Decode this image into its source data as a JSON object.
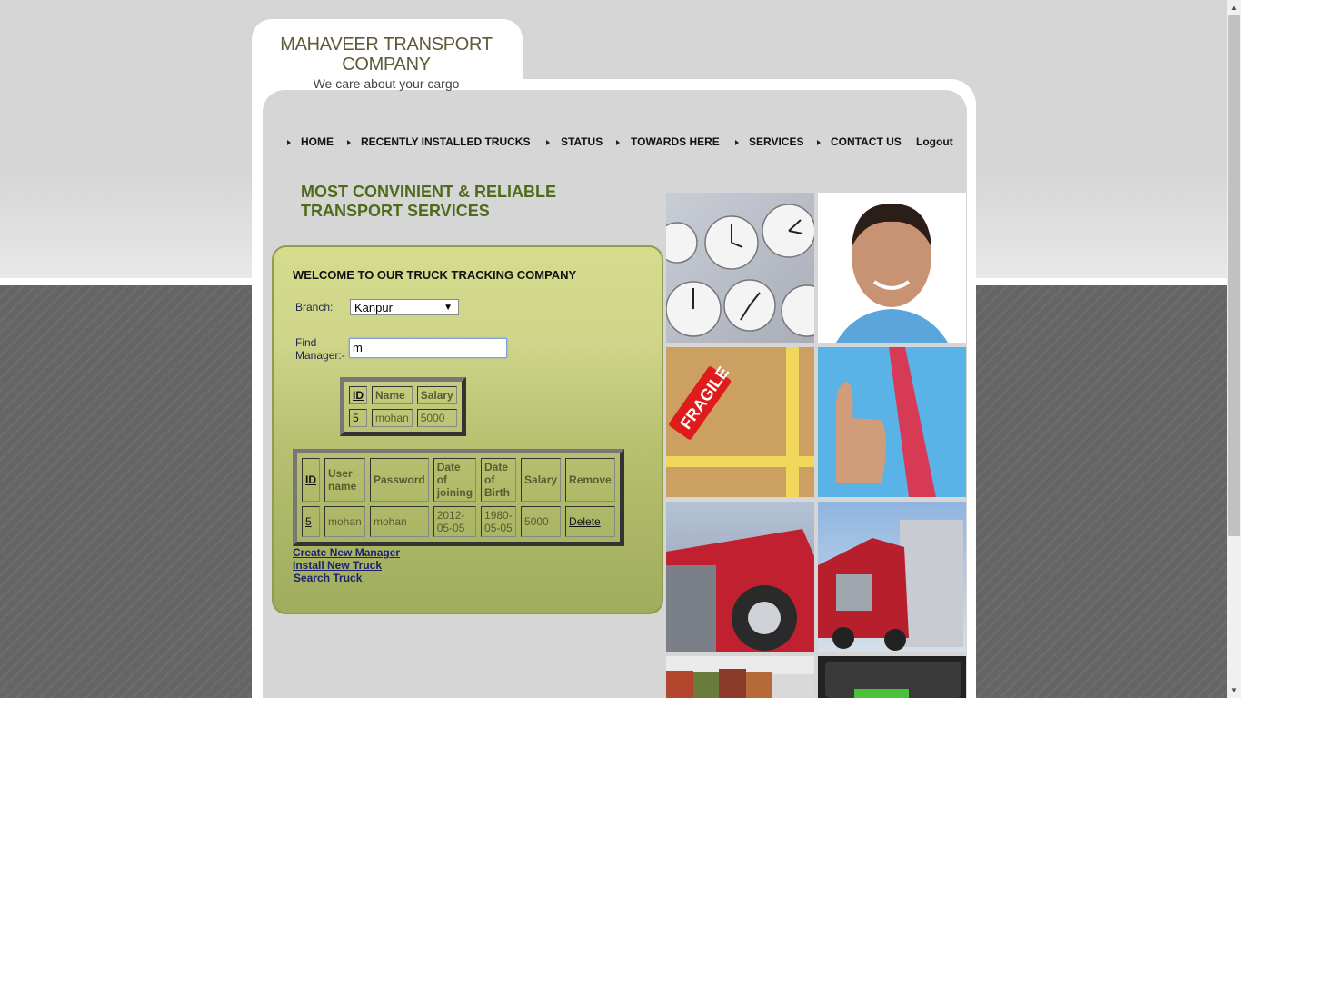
{
  "header": {
    "company_name": "MAHAVEER TRANSPORT COMPANY",
    "tagline": "We care about your cargo"
  },
  "nav": {
    "items": [
      "HOME",
      "RECENTLY INSTALLED TRUCKS",
      "STATUS",
      "TOWARDS HERE",
      "SERVICES",
      "CONTACT US",
      "Logout"
    ]
  },
  "slogan": {
    "line1": "MOST CONVINIENT & RELIABLE",
    "line2": "TRANSPORT SERVICES"
  },
  "welcome": {
    "title": "WELCOME TO OUR TRUCK TRACKING COMPANY",
    "branch_label": "Branch:",
    "branch_value": "Kanpur",
    "find_label": "Find Manager:-",
    "find_value": "m"
  },
  "search_results": {
    "headers": [
      "ID",
      "Name",
      "Salary"
    ],
    "rows": [
      [
        "5",
        "mohan",
        "5000"
      ]
    ]
  },
  "manager_table": {
    "headers": [
      "ID",
      "User name",
      "Password",
      "Date of joining",
      "Date of Birth",
      "Salary",
      "Remove"
    ],
    "rows": [
      [
        "5",
        "mohan",
        "mohan",
        "2012-05-05",
        "1980-05-05",
        "5000",
        "Delete"
      ]
    ]
  },
  "links": [
    "Create New Manager",
    "Install New Truck",
    "Search Truck"
  ],
  "images": [
    "clocks",
    "smiling-man",
    "fragile-box",
    "thumbs-up-man",
    "red-truck-front",
    "red-truck-side",
    "containers",
    "keyboard-key"
  ],
  "scrollbar": {
    "up": "▲",
    "down": "▼"
  }
}
